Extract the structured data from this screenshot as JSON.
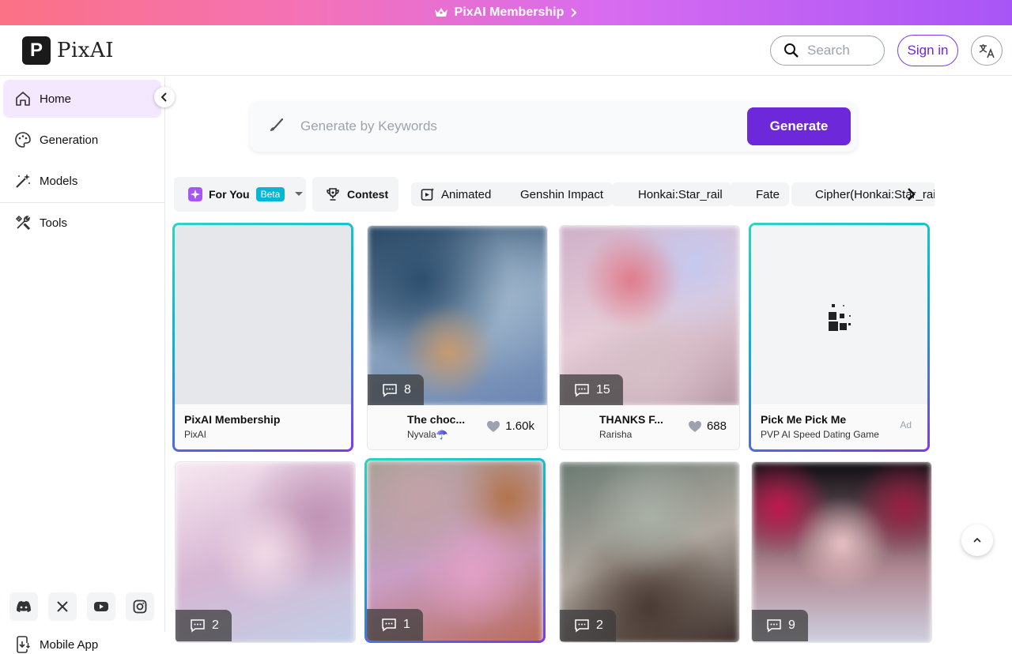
{
  "banner": {
    "label": "PixAI Membership"
  },
  "header": {
    "logo_letter": "P",
    "logo_text": "PixAI",
    "search_placeholder": "Search",
    "signin_label": "Sign in"
  },
  "sidebar": {
    "items": [
      {
        "label": "Home",
        "icon": "home-icon"
      },
      {
        "label": "Generation",
        "icon": "palette-icon"
      },
      {
        "label": "Models",
        "icon": "magic-wand-icon"
      },
      {
        "label": "Tools",
        "icon": "tools-icon"
      }
    ],
    "mobile_app": "Mobile App",
    "socials": [
      "discord-icon",
      "x-icon",
      "youtube-icon",
      "instagram-icon"
    ]
  },
  "generate": {
    "placeholder": "Generate by Keywords",
    "button": "Generate"
  },
  "tags": {
    "for_you": "For You",
    "beta": "Beta",
    "contest": "Contest",
    "items": [
      "Animated",
      "Genshin Impact",
      "Honkai:Star_rail",
      "Fate",
      "Cipher(Honkai:Star_rai"
    ]
  },
  "cards": [
    {
      "title": "PixAI Membership",
      "author": "PixAI"
    },
    {
      "title": "The choc...",
      "author": "Nyvala☂️",
      "likes": "1.60k",
      "comments": "8"
    },
    {
      "title": "THANKS F...",
      "author": "Rarisha",
      "likes": "688",
      "comments": "15"
    },
    {
      "title": "Pick Me Pick Me",
      "author": "PVP AI Speed Dating Game",
      "ad": "Ad"
    },
    {
      "comments": "2"
    },
    {
      "comments": "1"
    },
    {
      "comments": "2"
    },
    {
      "comments": "9"
    }
  ],
  "colors": {
    "accent": "#6d28d9",
    "active_bg": "#f3e8ff",
    "beta": "#06b6d4"
  }
}
